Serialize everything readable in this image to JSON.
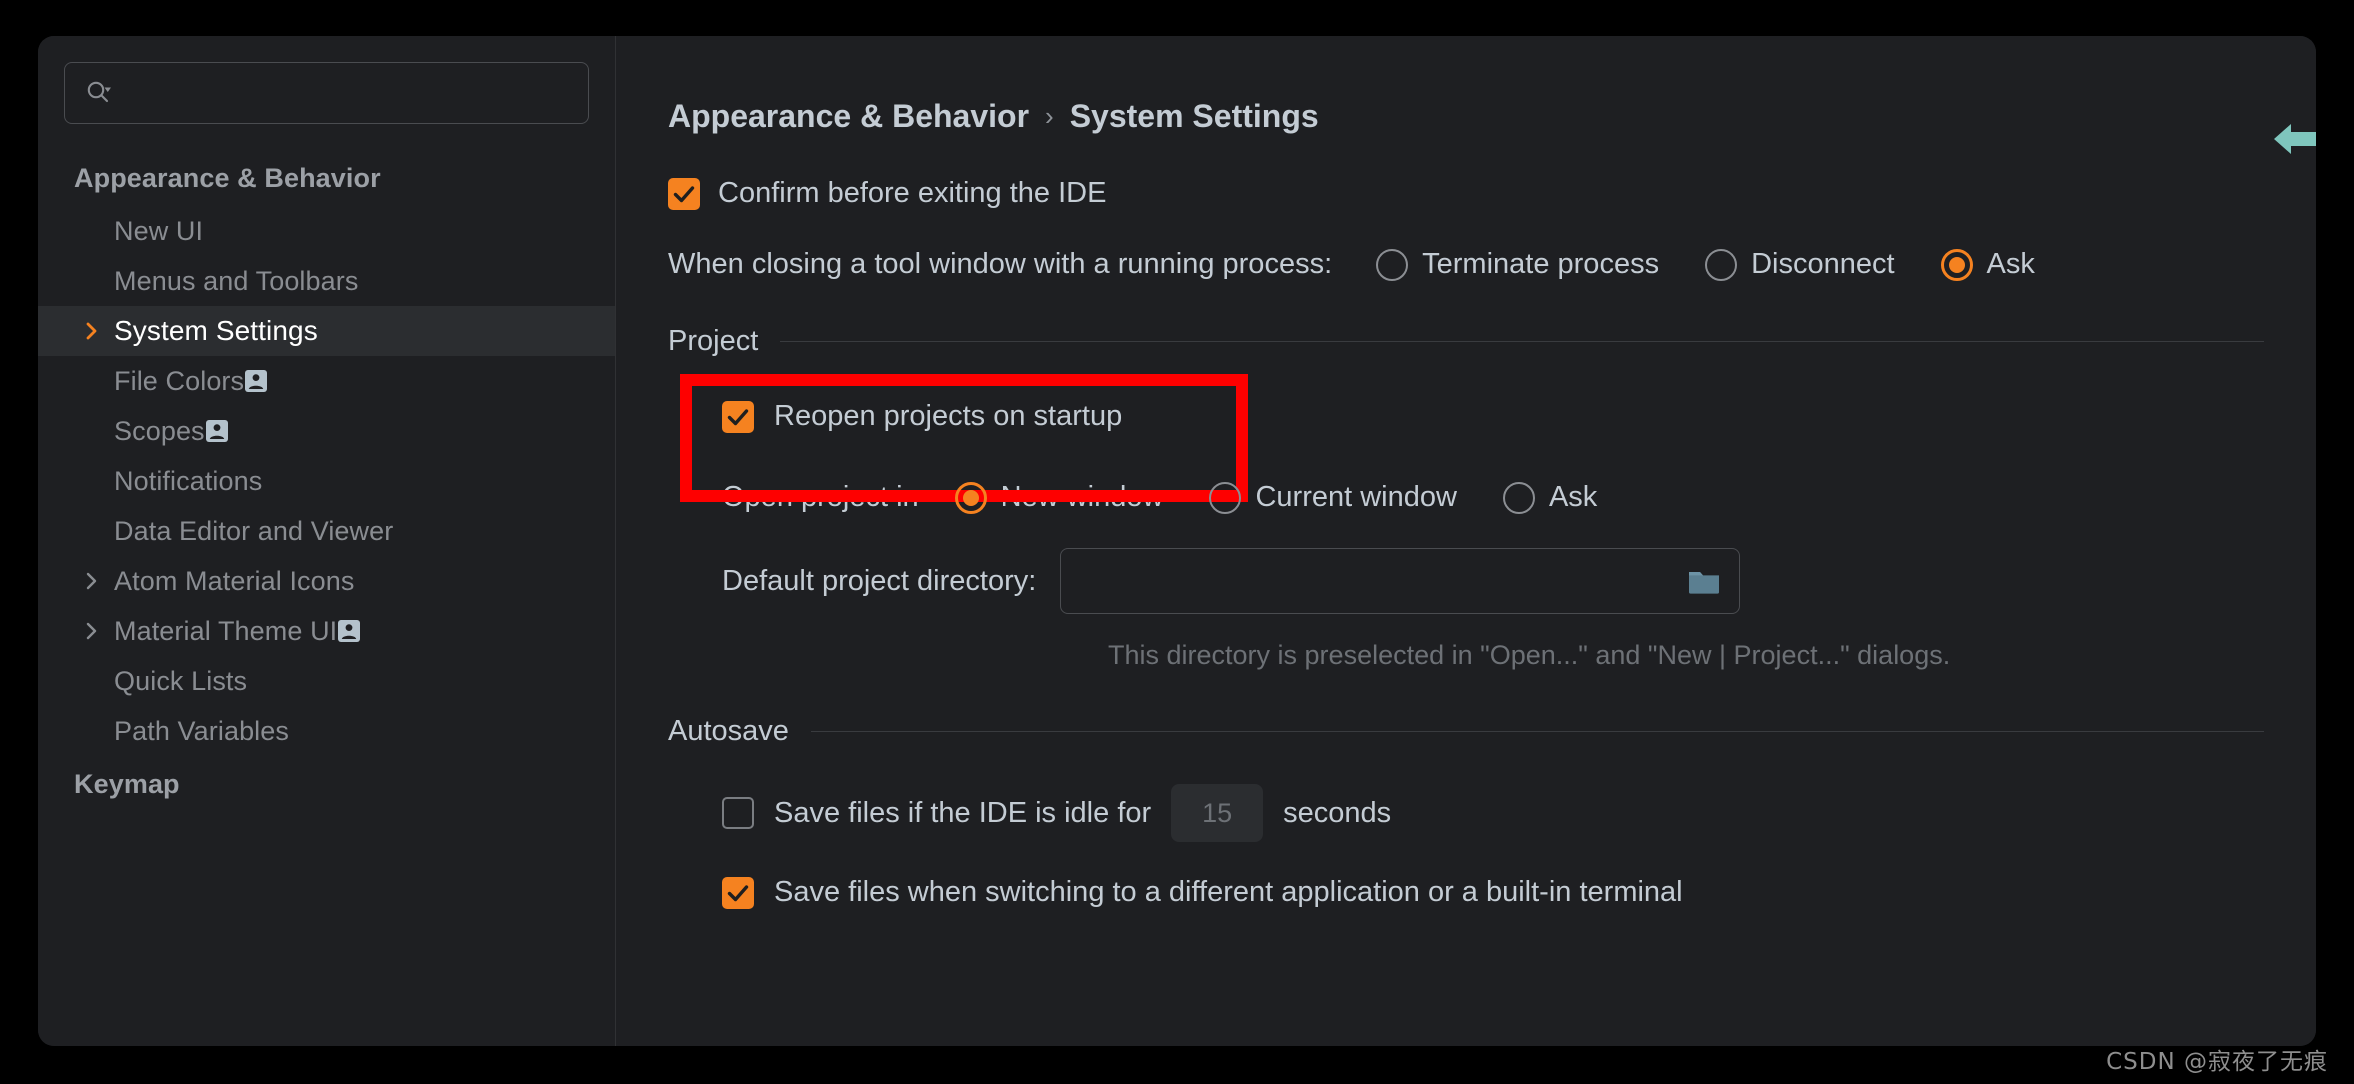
{
  "window": {
    "accent_orange": "#f58220",
    "annotation_red": "#fe0000",
    "teal": "#7fc6bd",
    "background": "#1e1f22",
    "selected_row": "#2b2d30"
  },
  "sidebar": {
    "search": {
      "placeholder": "",
      "value": "",
      "icon": "search-icon"
    },
    "items": [
      {
        "label": "Appearance & Behavior",
        "level": "top",
        "chevron": "none",
        "badge": false,
        "selected": false
      },
      {
        "label": "New UI",
        "level": "child",
        "chevron": "none",
        "badge": false,
        "selected": false
      },
      {
        "label": "Menus and Toolbars",
        "level": "child",
        "chevron": "none",
        "badge": false,
        "selected": false
      },
      {
        "label": "System Settings",
        "level": "child",
        "chevron": "right-orange",
        "badge": false,
        "selected": true
      },
      {
        "label": "File Colors",
        "level": "child",
        "chevron": "none",
        "badge": true,
        "selected": false
      },
      {
        "label": "Scopes",
        "level": "child",
        "chevron": "none",
        "badge": true,
        "selected": false
      },
      {
        "label": "Notifications",
        "level": "child",
        "chevron": "none",
        "badge": false,
        "selected": false
      },
      {
        "label": "Data Editor and Viewer",
        "level": "child",
        "chevron": "none",
        "badge": false,
        "selected": false
      },
      {
        "label": "Atom Material Icons",
        "level": "child",
        "chevron": "right-gray",
        "badge": false,
        "selected": false
      },
      {
        "label": "Material Theme UI",
        "level": "child",
        "chevron": "right-gray",
        "badge": true,
        "selected": false
      },
      {
        "label": "Quick Lists",
        "level": "child",
        "chevron": "none",
        "badge": false,
        "selected": false
      },
      {
        "label": "Path Variables",
        "level": "child",
        "chevron": "none",
        "badge": false,
        "selected": false
      },
      {
        "label": "Keymap",
        "level": "top",
        "chevron": "none",
        "badge": false,
        "selected": false
      }
    ]
  },
  "breadcrumb": {
    "root": "Appearance & Behavior",
    "separator": "›",
    "current": "System Settings"
  },
  "main": {
    "confirm_exit": {
      "label": "Confirm before exiting the IDE",
      "checked": true
    },
    "closing_tool_window": {
      "question": "When closing a tool window with a running process:",
      "options": [
        {
          "label": "Terminate process",
          "selected": false
        },
        {
          "label": "Disconnect",
          "selected": false
        },
        {
          "label": "Ask",
          "selected": true
        }
      ]
    },
    "project_section": {
      "title": "Project",
      "reopen": {
        "label": "Reopen projects on startup",
        "checked": true,
        "highlighted": true
      },
      "open_project_in": {
        "lead": "Open project in",
        "options": [
          {
            "label": "New window",
            "selected": true
          },
          {
            "label": "Current window",
            "selected": false
          },
          {
            "label": "Ask",
            "selected": false
          }
        ]
      },
      "default_dir": {
        "label": "Default project directory:",
        "value": "",
        "placeholder": "",
        "button_icon": "folder-icon"
      },
      "hint": "This directory is preselected in \"Open...\" and \"New | Project...\" dialogs."
    },
    "autosave_section": {
      "title": "Autosave",
      "idle_save": {
        "label_before": "Save files if the IDE is idle for",
        "seconds_value": "15",
        "label_after": "seconds",
        "checked": false,
        "field_disabled": true
      },
      "switch_save": {
        "label": "Save files when switching to a different application or a built-in terminal",
        "checked": true
      }
    }
  },
  "overlays": {
    "teal_arrow": "arrow-left-icon",
    "watermark": "CSDN @寂夜了无痕"
  }
}
